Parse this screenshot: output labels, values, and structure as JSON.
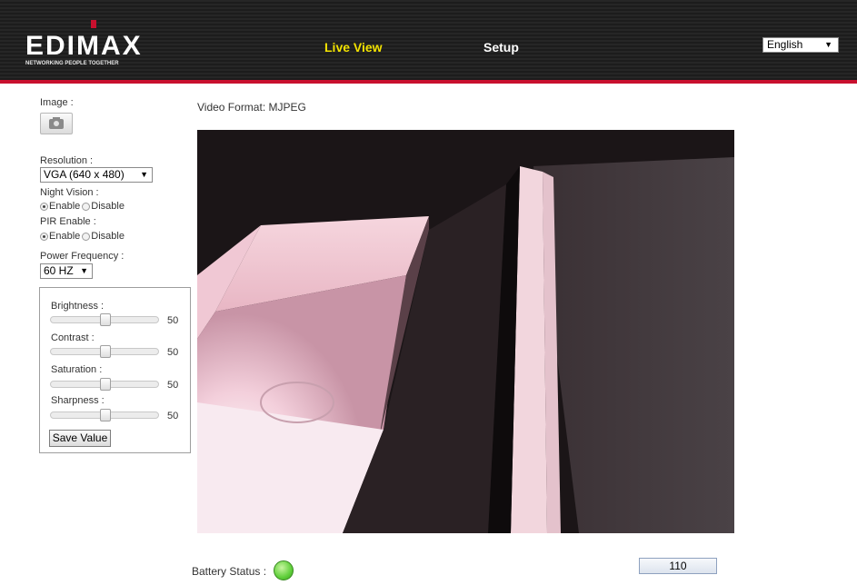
{
  "header": {
    "logo_text": "EDIMAX",
    "logo_tagline": "NETWORKING PEOPLE TOGETHER",
    "nav": [
      {
        "label": "Live View",
        "active": true
      },
      {
        "label": "Setup",
        "active": false
      }
    ],
    "language": {
      "selected": "English"
    }
  },
  "sidebar": {
    "image_label": "Image :",
    "resolution_label": "Resolution :",
    "resolution_value": "VGA (640 x 480)",
    "night_vision_label": "Night Vision :",
    "night_vision_enable": "Enable",
    "night_vision_disable": "Disable",
    "night_vision_selected": "Enable",
    "pir_label": "PIR Enable :",
    "pir_enable": "Enable",
    "pir_disable": "Disable",
    "pir_selected": "Enable",
    "power_frequency_label": "Power Frequency :",
    "power_frequency_value": "60 HZ",
    "adjustments": [
      {
        "label": "Brightness :",
        "value": "50",
        "fraction": 0.5
      },
      {
        "label": "Contrast :",
        "value": "50",
        "fraction": 0.5
      },
      {
        "label": "Saturation :",
        "value": "50",
        "fraction": 0.5
      },
      {
        "label": "Sharpness :",
        "value": "50",
        "fraction": 0.5
      }
    ],
    "save_label": "Save Value"
  },
  "main": {
    "video_format": "Video Format:  MJPEG",
    "battery_label": "Battery Status :",
    "counter_value": "110"
  },
  "colors": {
    "nav_active": "#f2e200",
    "header_accent": "#c8102e",
    "battery_ok": "#5fcf3a"
  },
  "icons": {
    "snapshot": "camera-icon",
    "battery": "battery-status-icon"
  }
}
